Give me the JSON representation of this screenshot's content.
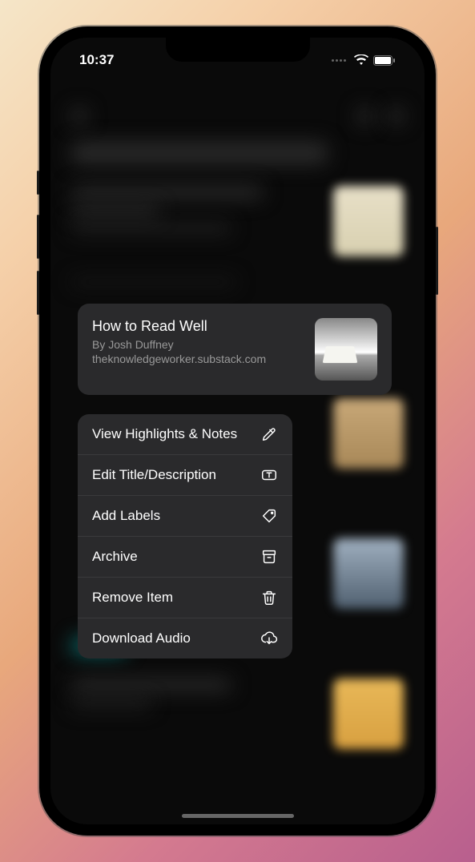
{
  "statusBar": {
    "time": "10:37"
  },
  "preview": {
    "title": "How to Read Well",
    "author": "By Josh Duffney",
    "source": "theknowledgeworker.substack.com"
  },
  "menu": {
    "items": [
      {
        "label": "View Highlights & Notes",
        "icon": "pencil-icon"
      },
      {
        "label": "Edit Title/Description",
        "icon": "text-box-icon"
      },
      {
        "label": "Add Labels",
        "icon": "tag-icon"
      },
      {
        "label": "Archive",
        "icon": "archive-icon"
      },
      {
        "label": "Remove Item",
        "icon": "trash-icon"
      },
      {
        "label": "Download Audio",
        "icon": "cloud-download-icon"
      }
    ]
  }
}
